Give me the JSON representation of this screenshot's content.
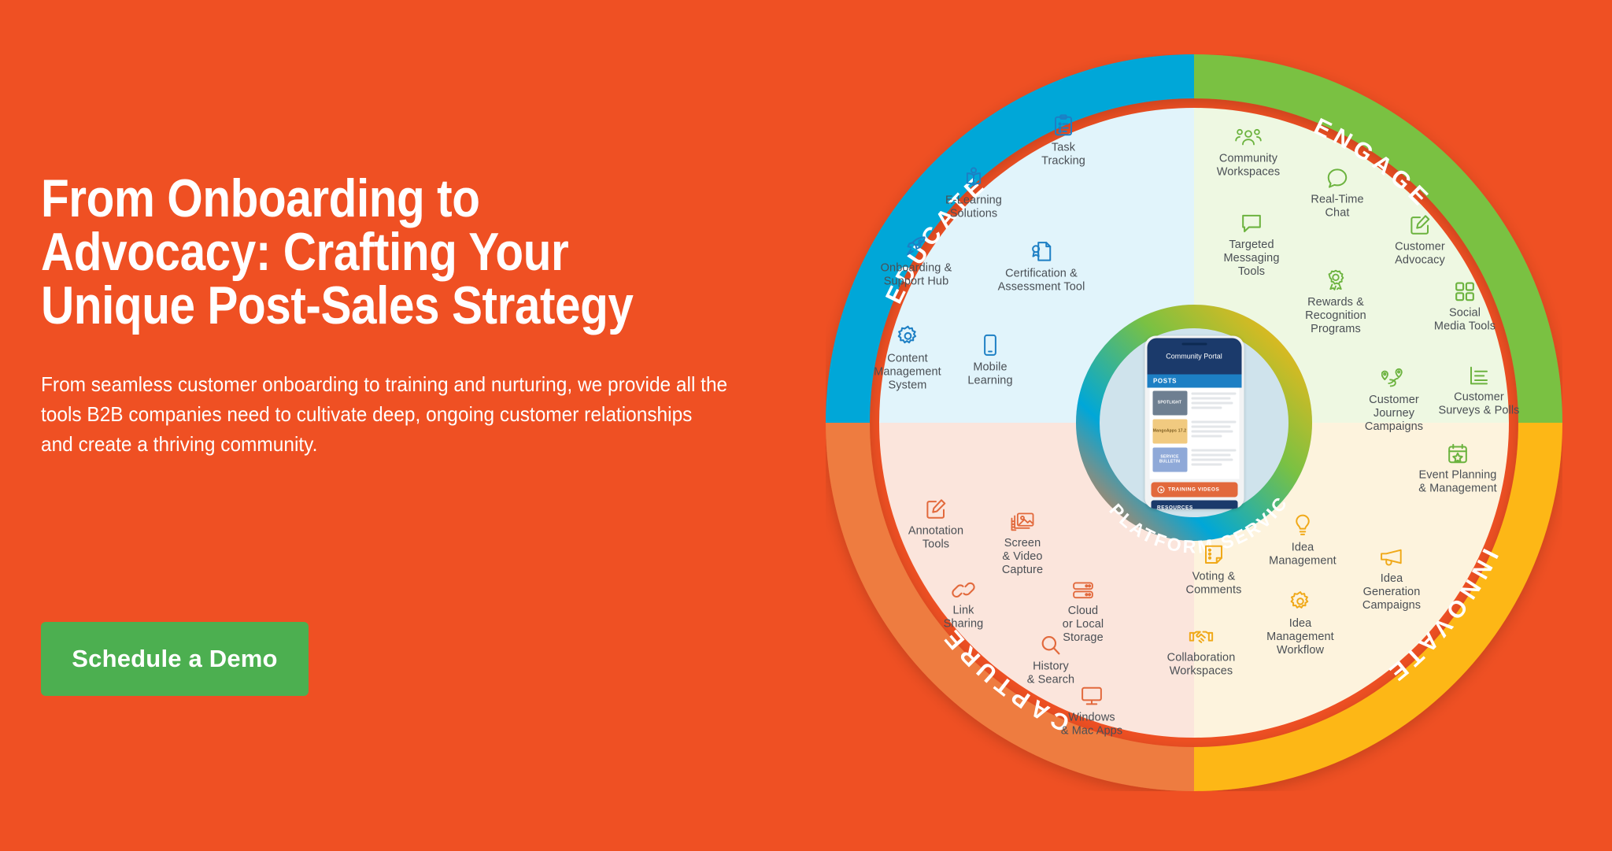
{
  "theme": {
    "background": "#ef5023",
    "cta_green": "#4caf50",
    "educate_blue": "#00a7d8",
    "engage_green": "#7ac143",
    "innovate_yellow": "#fdb714",
    "capture_orange": "#ee7b3f",
    "label_text": "#4a4f55"
  },
  "hero": {
    "title": "From Onboarding to Advocacy: Crafting Your Unique Post-Sales Strategy",
    "subtitle": "From seamless customer onboarding to training and nurturing, we provide all the tools B2B companies need to cultivate deep, ongoing customer relationships and create a thriving community.",
    "cta_label": "Schedule a Demo"
  },
  "wheel": {
    "center_label": "PLATFORM SERVICES",
    "quadrants": [
      {
        "name": "EDUCATE",
        "color": "#00a7d8",
        "fill": "#e1f4fb",
        "items": [
          {
            "label": "Task\nTracking",
            "icon": "clipboard-checklist-icon"
          },
          {
            "label": "E-Learning\nSolutions",
            "icon": "open-book-person-icon"
          },
          {
            "label": "Certification &\nAssessment Tool",
            "icon": "certificate-document-icon"
          },
          {
            "label": "Onboarding &\nSupport Hub",
            "icon": "rocket-icon"
          },
          {
            "label": "Content\nManagement\nSystem",
            "icon": "gear-icon"
          },
          {
            "label": "Mobile\nLearning",
            "icon": "mobile-phone-icon"
          }
        ]
      },
      {
        "name": "ENGAGE",
        "color": "#7ac143",
        "fill": "#eef8e2",
        "items": [
          {
            "label": "Community\nWorkspaces",
            "icon": "people-group-icon"
          },
          {
            "label": "Real-Time\nChat",
            "icon": "speech-bubble-icon"
          },
          {
            "label": "Customer\nAdvocacy",
            "icon": "edit-square-icon"
          },
          {
            "label": "Targeted\nMessaging\nTools",
            "icon": "message-box-icon"
          },
          {
            "label": "Rewards &\nRecognition\nPrograms",
            "icon": "award-rosette-icon"
          },
          {
            "label": "Social\nMedia Tools",
            "icon": "grid-squares-icon"
          },
          {
            "label": "Customer\nSurveys & Polls",
            "icon": "bar-list-icon"
          },
          {
            "label": "Customer\nJourney\nCampaigns",
            "icon": "journey-pins-icon"
          },
          {
            "label": "Event Planning\n& Management",
            "icon": "calendar-star-icon"
          }
        ]
      },
      {
        "name": "INNOVATE",
        "color": "#fdb714",
        "fill": "#fdf3dd",
        "items": [
          {
            "label": "Idea\nManagement",
            "icon": "lightbulb-icon"
          },
          {
            "label": "Idea\nGeneration\nCampaigns",
            "icon": "megaphone-icon"
          },
          {
            "label": "Voting &\nComments",
            "icon": "note-list-icon"
          },
          {
            "label": "Idea\nManagement\nWorkflow",
            "icon": "gear-icon"
          },
          {
            "label": "Collaboration\nWorkspaces",
            "icon": "handshake-icon"
          }
        ]
      },
      {
        "name": "CAPTURE",
        "color": "#ee7b3f",
        "fill": "#fbe5dc",
        "items": [
          {
            "label": "Annotation\nTools",
            "icon": "edit-square-icon"
          },
          {
            "label": "Screen\n& Video\nCapture",
            "icon": "screen-capture-icon"
          },
          {
            "label": "Link\nSharing",
            "icon": "chain-link-icon"
          },
          {
            "label": "Cloud\nor Local\nStorage",
            "icon": "server-storage-icon"
          },
          {
            "label": "History\n& Search",
            "icon": "magnifier-icon"
          },
          {
            "label": "Windows\n& Mac Apps",
            "icon": "desktop-monitor-icon"
          }
        ]
      }
    ]
  },
  "phone": {
    "title": "Community Portal",
    "posts_header": "POSTS",
    "cards": [
      {
        "label": "SPOTLIGHT"
      },
      {
        "label": "MangoApps 17.2"
      },
      {
        "label": "SERVICE BULLETIN"
      }
    ],
    "training_button": "TRAINING VIDEOS",
    "resources_bar": "RESOURCES"
  }
}
